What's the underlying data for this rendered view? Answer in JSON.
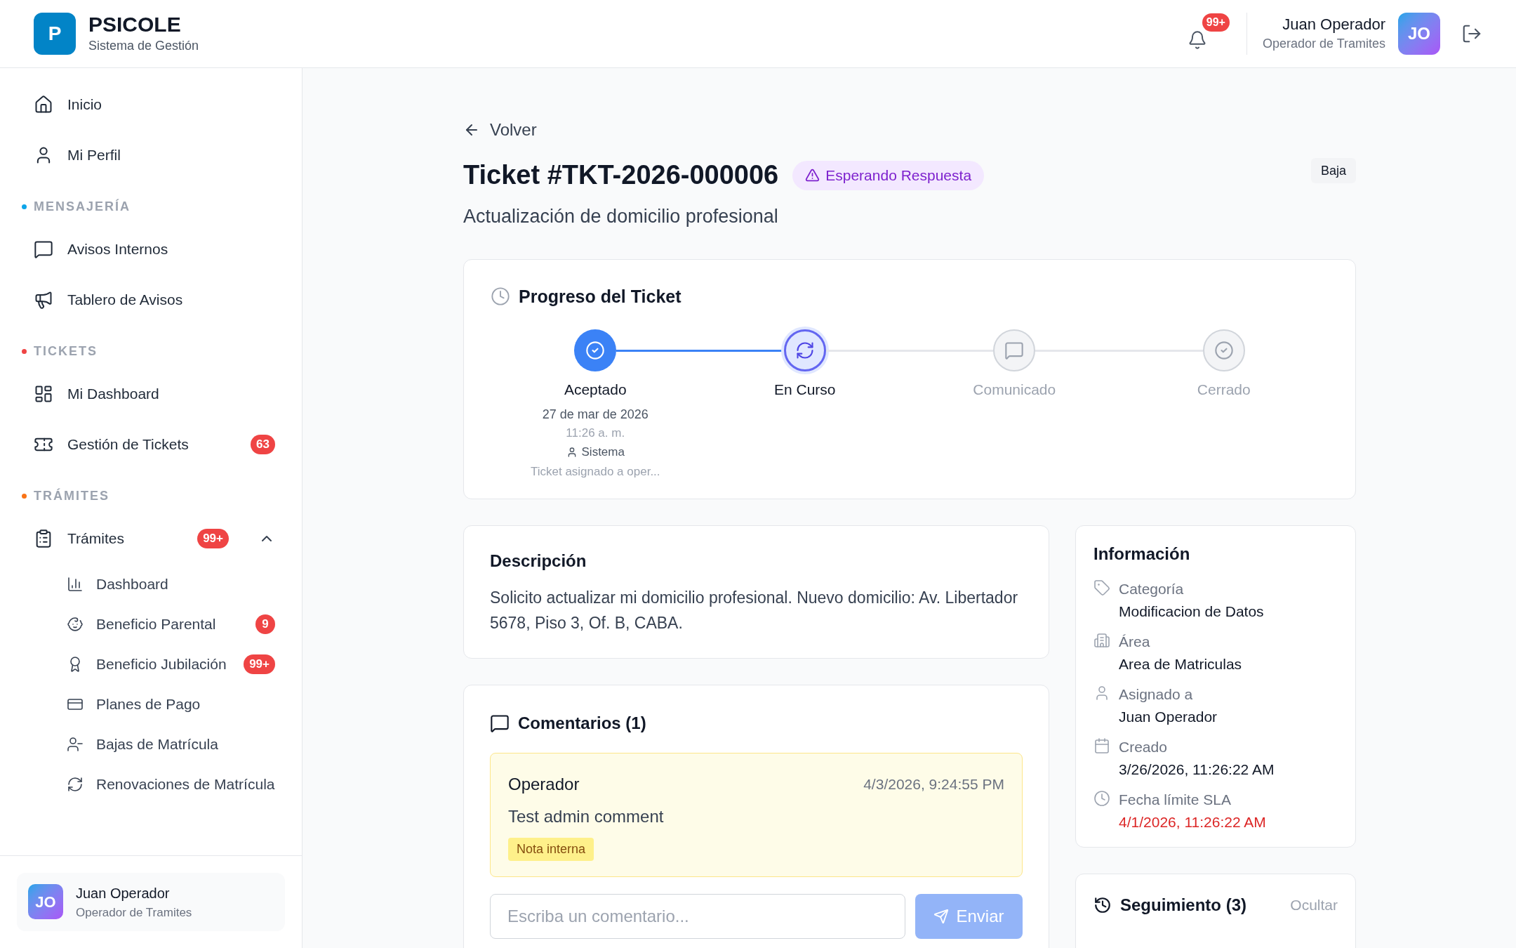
{
  "header": {
    "logo_letter": "P",
    "app_name": "PSICOLE",
    "app_subtitle": "Sistema de Gestión",
    "notifications_badge": "99+",
    "user": {
      "name": "Juan Operador",
      "role": "Operador de Tramites",
      "initials": "JO"
    }
  },
  "sidebar": {
    "sections": [
      {
        "items": [
          {
            "label": "Inicio"
          },
          {
            "label": "Mi Perfil"
          }
        ]
      },
      {
        "title": "MENSAJERÍA",
        "color": "#0ea5e9",
        "items": [
          {
            "label": "Avisos Internos"
          },
          {
            "label": "Tablero de Avisos"
          }
        ]
      },
      {
        "title": "TICKETS",
        "color": "#ef4444",
        "items": [
          {
            "label": "Mi Dashboard"
          },
          {
            "label": "Gestión de Tickets",
            "badge": "63"
          }
        ]
      },
      {
        "title": "TRÁMITES",
        "color": "#f97316",
        "items": [
          {
            "label": "Trámites",
            "badge": "99+",
            "expanded": true,
            "children": [
              {
                "label": "Dashboard"
              },
              {
                "label": "Beneficio Parental",
                "badge": "9"
              },
              {
                "label": "Beneficio Jubilación",
                "badge": "99+"
              },
              {
                "label": "Planes de Pago"
              },
              {
                "label": "Bajas de Matrícula"
              },
              {
                "label": "Renovaciones de Matrícula"
              }
            ]
          }
        ]
      }
    ],
    "user": {
      "name": "Juan Operador",
      "role": "Operador de Tramites",
      "initials": "JO"
    }
  },
  "ticket": {
    "back_label": "Volver",
    "title": "Ticket #TKT-2026-000006",
    "status_badge": "Esperando Respuesta",
    "priority": "Baja",
    "subtitle": "Actualización de domicilio profesional"
  },
  "progress": {
    "title": "Progreso del Ticket",
    "steps": [
      {
        "label": "Aceptado",
        "done": true,
        "current": false,
        "date": "27 de mar de 2026",
        "time": "11:26 a. m.",
        "user": "Sistema",
        "note": "Ticket asignado a oper..."
      },
      {
        "label": "En Curso",
        "done": false,
        "current": true
      },
      {
        "label": "Comunicado",
        "done": false,
        "current": false
      },
      {
        "label": "Cerrado",
        "done": false,
        "current": false
      }
    ]
  },
  "description": {
    "title": "Descripción",
    "text": "Solicito actualizar mi domicilio profesional. Nuevo domicilio: Av. Libertador 5678, Piso 3, Of. B, CABA."
  },
  "comments": {
    "title": "Comentarios (1)",
    "items": [
      {
        "author": "Operador",
        "time": "4/3/2026, 9:24:55 PM",
        "text": "Test admin comment",
        "tag": "Nota interna"
      }
    ],
    "placeholder": "Escriba un comentario...",
    "send_label": "Enviar"
  },
  "info": {
    "title": "Información",
    "fields": [
      {
        "label": "Categoría",
        "value": "Modificacion de Datos",
        "overdue": false
      },
      {
        "label": "Área",
        "value": "Area de Matriculas",
        "overdue": false
      },
      {
        "label": "Asignado a",
        "value": "Juan Operador",
        "overdue": false
      },
      {
        "label": "Creado",
        "value": "3/26/2026, 11:26:22 AM",
        "overdue": false
      },
      {
        "label": "Fecha límite SLA",
        "value": "4/1/2026, 11:26:22 AM",
        "overdue": true
      }
    ]
  },
  "followup": {
    "title": "Seguimiento (3)",
    "toggle_label": "Ocultar"
  }
}
